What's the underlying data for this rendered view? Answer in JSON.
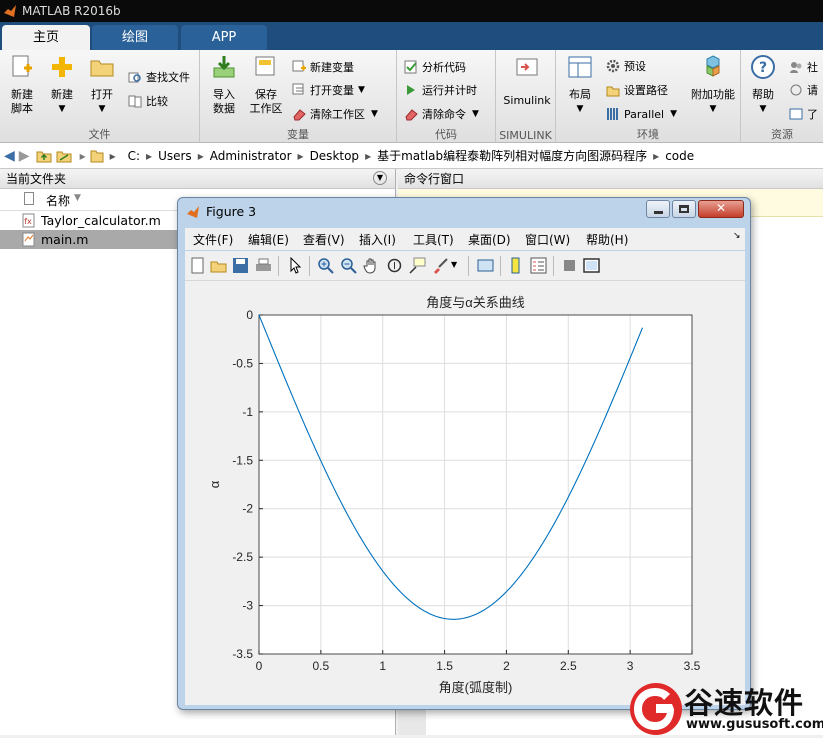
{
  "app": {
    "title": "MATLAB R2016b"
  },
  "tabs": [
    {
      "label": "主页"
    },
    {
      "label": "绘图"
    },
    {
      "label": "APP"
    }
  ],
  "ribbon": {
    "file": {
      "group_label": "文件",
      "new_script": "新建\n脚本",
      "new": "新建",
      "open": "打开",
      "find_files": "查找文件",
      "compare": "比较"
    },
    "variable": {
      "group_label": "变量",
      "import": "导入\n数据",
      "save_workspace": "保存\n工作区",
      "new_variable": "新建变量",
      "open_variable": "打开变量",
      "clear_workspace": "清除工作区"
    },
    "code": {
      "group_label": "代码",
      "analyze": "分析代码",
      "run_time": "运行并计时",
      "clear_commands": "清除命令"
    },
    "simulink": {
      "group_label": "SIMULINK",
      "simulink": "Simulink"
    },
    "env": {
      "group_label": "环境",
      "layout": "布局",
      "preferences": "预设",
      "set_path": "设置路径",
      "parallel": "Parallel",
      "addons": "附加功能"
    },
    "resources": {
      "group_label": "资源",
      "help": "帮助",
      "community": "社",
      "request": "请",
      "learn": "了"
    }
  },
  "address": {
    "segments": [
      "C:",
      "Users",
      "Administrator",
      "Desktop",
      "基于matlab编程泰勒阵列相对幅度方向图源码程序",
      "code"
    ]
  },
  "left_panel": {
    "title": "当前文件夹",
    "col_name": "名称",
    "files": [
      {
        "name": "Taylor_calculator.m"
      },
      {
        "name": "main.m"
      }
    ]
  },
  "right_panel": {
    "title": "命令行窗口"
  },
  "figure": {
    "title": "Figure 3",
    "menu": [
      "文件(F)",
      "编辑(E)",
      "查看(V)",
      "插入(I)",
      "工具(T)",
      "桌面(D)",
      "窗口(W)",
      "帮助(H)"
    ]
  },
  "chart_data": {
    "type": "line",
    "title": "角度与α关系曲线",
    "xlabel": "角度(弧度制)",
    "ylabel": "α",
    "xlim": [
      0,
      3.5
    ],
    "ylim": [
      -3.5,
      0
    ],
    "xticks": [
      "0",
      "0.5",
      "1",
      "1.5",
      "2",
      "2.5",
      "3",
      "3.5"
    ],
    "yticks": [
      "0",
      "-0.5",
      "-1",
      "-1.5",
      "-2",
      "-2.5",
      "-3",
      "-3.5"
    ],
    "grid": true,
    "color": "#0072bd",
    "x_range": [
      0,
      3.1
    ],
    "formula": "α = -2π/λ·d·sin(x) style curve; sampled values follow",
    "x": [
      0,
      0.2,
      0.4,
      0.6,
      0.8,
      1.0,
      1.2,
      1.4,
      1.5708,
      1.8,
      2.0,
      2.2,
      2.4,
      2.6,
      2.8,
      3.0,
      3.1
    ],
    "y": [
      0,
      -0.62,
      -1.22,
      -1.77,
      -2.25,
      -2.64,
      -2.93,
      -3.1,
      -3.14,
      -3.05,
      -2.86,
      -2.53,
      -2.12,
      -1.62,
      -1.05,
      -0.44,
      -0.13
    ]
  },
  "watermark": {
    "text": "谷速软件",
    "url": "www.gususoft.com"
  },
  "colors": {
    "accent": "#1f4d7d",
    "line": "#0072bd",
    "watermark_red": "#e02a2a"
  }
}
